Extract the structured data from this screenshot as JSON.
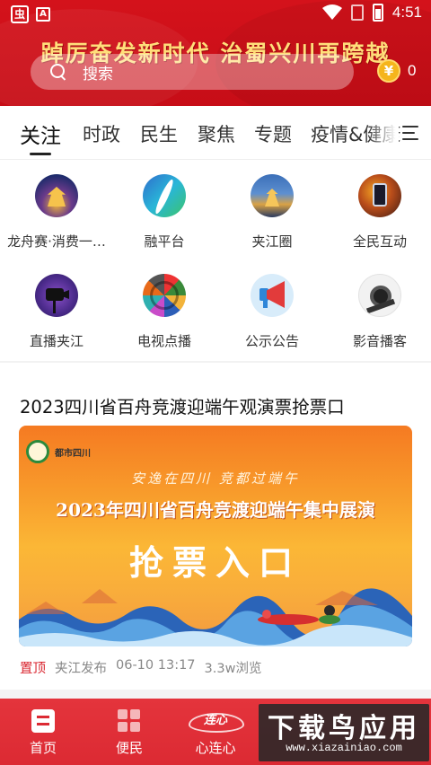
{
  "status_bar": {
    "time": "4:51",
    "app_icon_1": "虫",
    "app_icon_2": "A",
    "icons": [
      "wifi-icon",
      "sim-icon",
      "battery-icon"
    ]
  },
  "header": {
    "slogan": "踔厉奋发新时代 治蜀兴川再跨越",
    "search_placeholder": "搜索",
    "coin_symbol": "¥",
    "coin_count": "0",
    "brand_color": "#d4121b"
  },
  "tabs": [
    {
      "label": "关注",
      "active": true
    },
    {
      "label": "时政"
    },
    {
      "label": "民生"
    },
    {
      "label": "聚焦"
    },
    {
      "label": "专题"
    },
    {
      "label": "疫情&健康"
    }
  ],
  "grid": [
    {
      "label": "龙舟赛·消费一…",
      "icon": "dragon-boat-icon"
    },
    {
      "label": "融平台",
      "icon": "fusion-platform-icon"
    },
    {
      "label": "夹江圈",
      "icon": "jiajiang-circle-icon"
    },
    {
      "label": "全民互动",
      "icon": "interaction-icon"
    },
    {
      "label": "直播夹江",
      "icon": "live-camera-icon"
    },
    {
      "label": "电视点播",
      "icon": "tv-vod-icon"
    },
    {
      "label": "公示公告",
      "icon": "megaphone-icon"
    },
    {
      "label": "影音播客",
      "icon": "podcast-icon"
    }
  ],
  "article": {
    "title": "2023四川省百舟竞渡迎端午观演票抢票口",
    "banner": {
      "logo_text": "都市四川",
      "subtitle": "安逸在四川 竞都过端午",
      "headline": "2023年四川省百舟竞渡迎端午集中展演",
      "main": "抢票入口"
    },
    "pinned": "置顶",
    "source": "夹江发布",
    "time": "06-10 13:17",
    "views": "3.3w浏览"
  },
  "bottom_nav": [
    {
      "label": "首页",
      "icon": "home-icon"
    },
    {
      "label": "便民",
      "icon": "services-grid-icon"
    },
    {
      "label": "心连心",
      "icon": "heart-link-icon",
      "logo_text": "连心"
    }
  ],
  "watermark": {
    "text": "下载鸟应用",
    "url": "www.xiazainiao.com"
  }
}
